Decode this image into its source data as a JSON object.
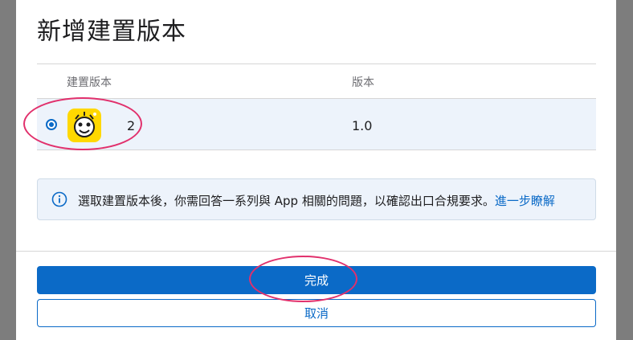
{
  "dialog": {
    "title": "新增建置版本",
    "columns": {
      "build": "建置版本",
      "version": "版本"
    },
    "rows": [
      {
        "selected": true,
        "icon": "app-icon-smiley",
        "build": "2",
        "version": "1.0"
      }
    ],
    "info": {
      "text": "選取建置版本後，你需回答一系列與 App 相關的問題，以確認出口合規要求。",
      "link": "進一步瞭解"
    },
    "buttons": {
      "done": "完成",
      "cancel": "取消"
    }
  },
  "colors": {
    "accent": "#0b6ac7",
    "annotation": "#e1306c",
    "row_bg": "#edf3fb"
  }
}
